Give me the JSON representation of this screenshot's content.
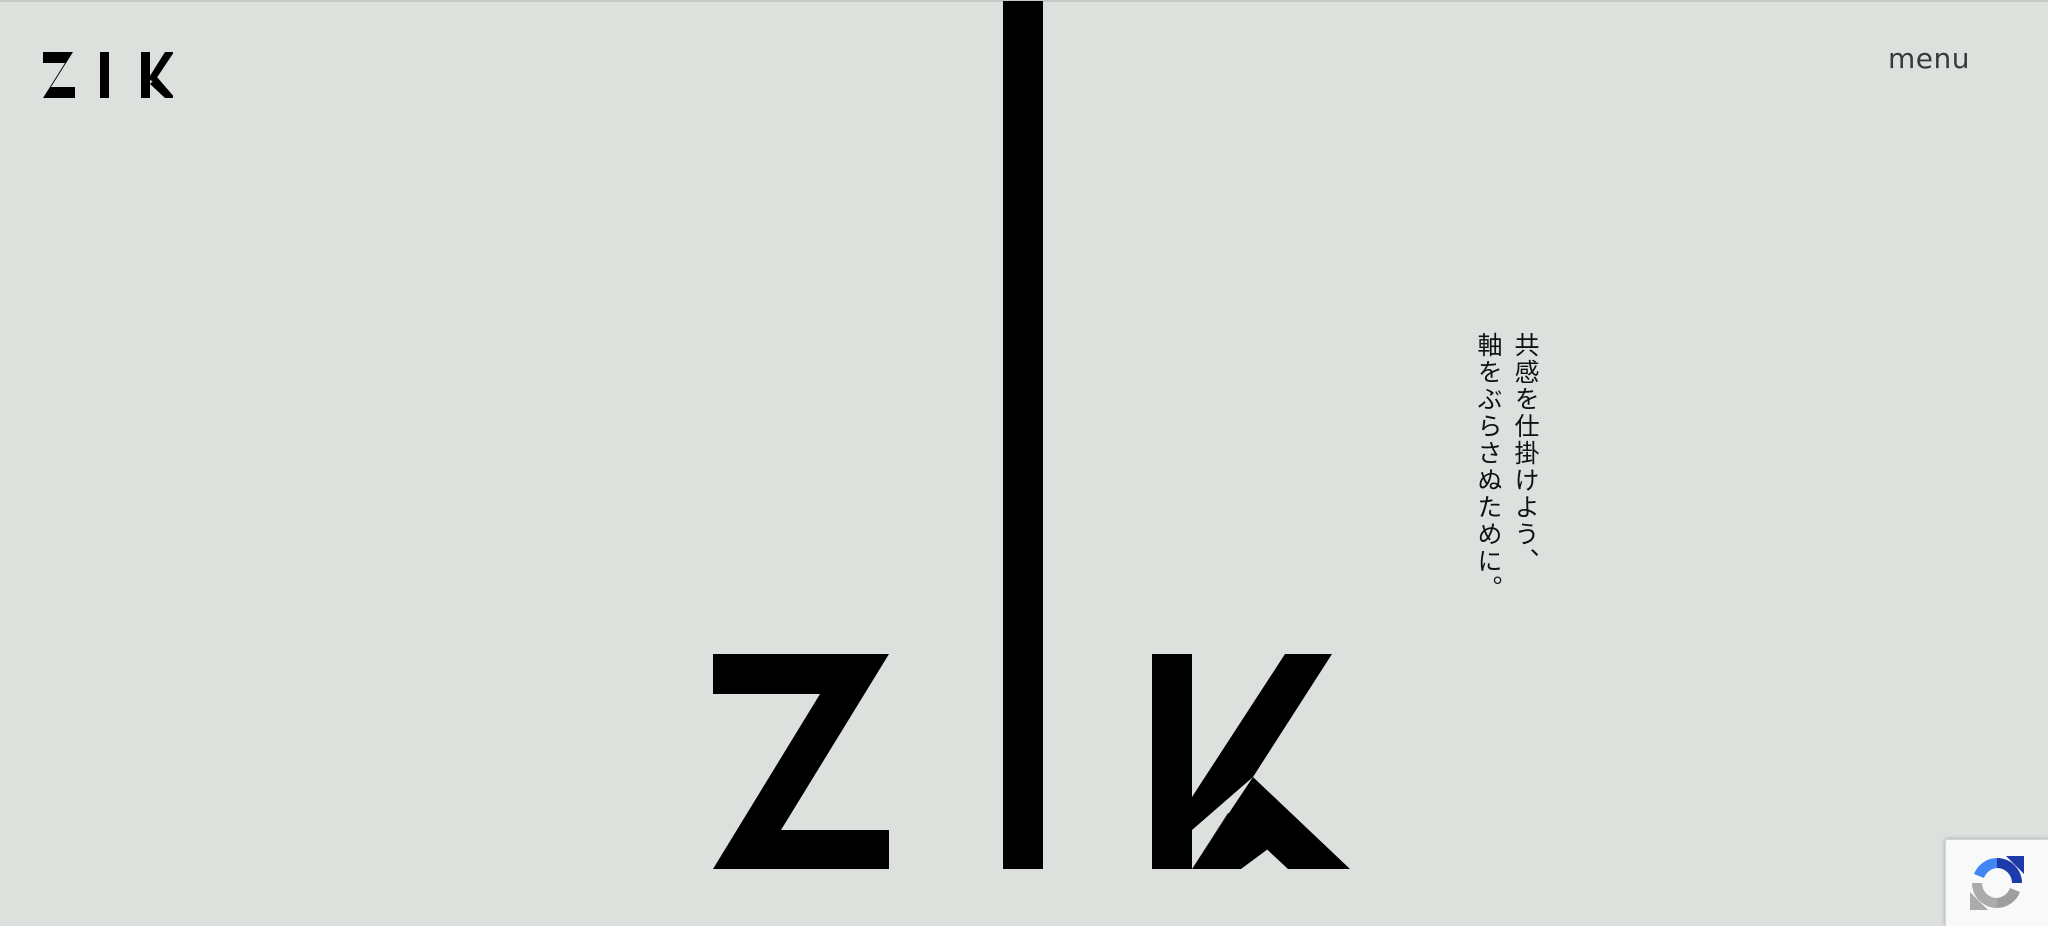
{
  "header": {
    "logo_text": "ZIK",
    "menu_label": "menu"
  },
  "hero": {
    "logo_text": "ZIK",
    "tagline_lines": [
      "共感を仕掛けよう、",
      "軸をぶらさぬために。"
    ]
  },
  "recaptcha": {
    "icon": "recaptcha-icon"
  },
  "colors": {
    "background": "#dce1de",
    "logo": "#000000",
    "text": "#1a1a1a"
  }
}
